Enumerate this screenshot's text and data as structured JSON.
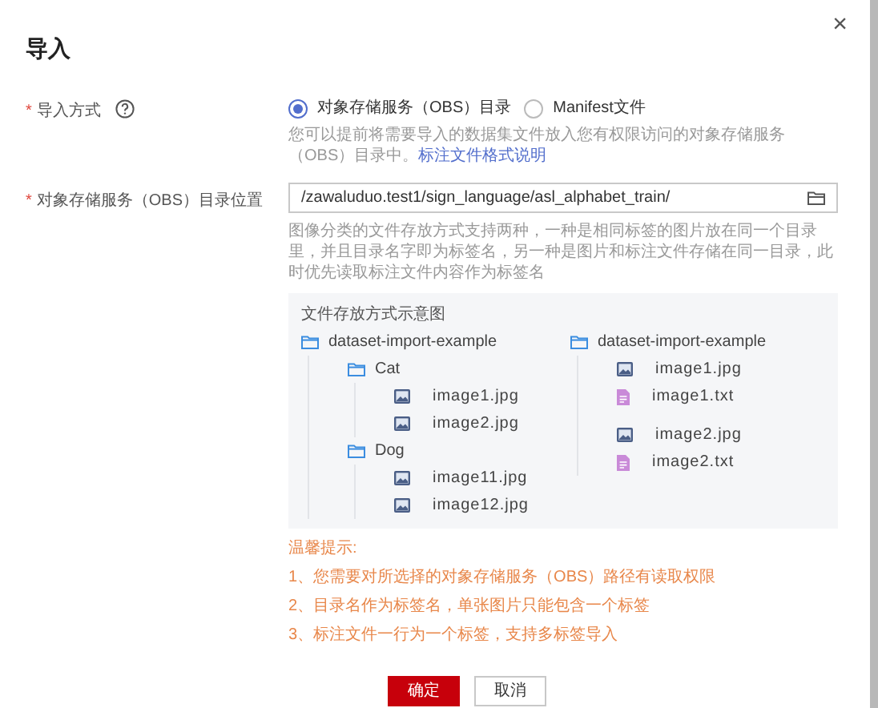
{
  "dialog": {
    "title": "导入",
    "close": "×"
  },
  "import_mode": {
    "label": "导入方式",
    "required_mark": "*",
    "options": [
      {
        "label": "对象存储服务（OBS）目录",
        "selected": true
      },
      {
        "label": "Manifest文件",
        "selected": false
      }
    ],
    "hint": "您可以提前将需要导入的数据集文件放入您有权限访问的对象存储服务（OBS）目录中。",
    "hint_link": "标注文件格式说明"
  },
  "obs_path": {
    "label": "对象存储服务（OBS）目录位置",
    "required_mark": "*",
    "value": "/zawaluduo.test1/sign_language/asl_alphabet_train/",
    "description": "图像分类的文件存放方式支持两种，一种是相同标签的图片放在同一个目录里，并且目录名字即为标签名，另一种是图片和标注文件存储在同一目录，此时优先读取标注文件内容作为标签名"
  },
  "example": {
    "title": "文件存放方式示意图",
    "trees": [
      {
        "kind": "folder",
        "name": "dataset-import-example",
        "children": [
          {
            "kind": "folder",
            "name": "Cat",
            "children": [
              {
                "kind": "image",
                "name": "image1.jpg"
              },
              {
                "kind": "image",
                "name": "image2.jpg"
              }
            ]
          },
          {
            "kind": "folder",
            "name": "Dog",
            "children": [
              {
                "kind": "image",
                "name": "image11.jpg"
              },
              {
                "kind": "image",
                "name": "image12.jpg"
              }
            ]
          }
        ]
      },
      {
        "kind": "folder",
        "name": "dataset-import-example",
        "children": [
          {
            "kind": "image",
            "name": "image1.jpg"
          },
          {
            "kind": "text",
            "name": "image1.txt"
          },
          {
            "kind": "image",
            "name": "image2.jpg"
          },
          {
            "kind": "text",
            "name": "image2.txt"
          }
        ]
      }
    ]
  },
  "tips": {
    "title": "温馨提示:",
    "items": [
      "1、您需要对所选择的对象存储服务（OBS）路径有读取权限",
      "2、目录名作为标签名，单张图片只能包含一个标签",
      "3、标注文件一行为一个标签，支持多标签导入"
    ]
  },
  "buttons": [
    {
      "label": "确定",
      "kind": "primary"
    },
    {
      "label": "取消",
      "kind": "secondary"
    }
  ]
}
